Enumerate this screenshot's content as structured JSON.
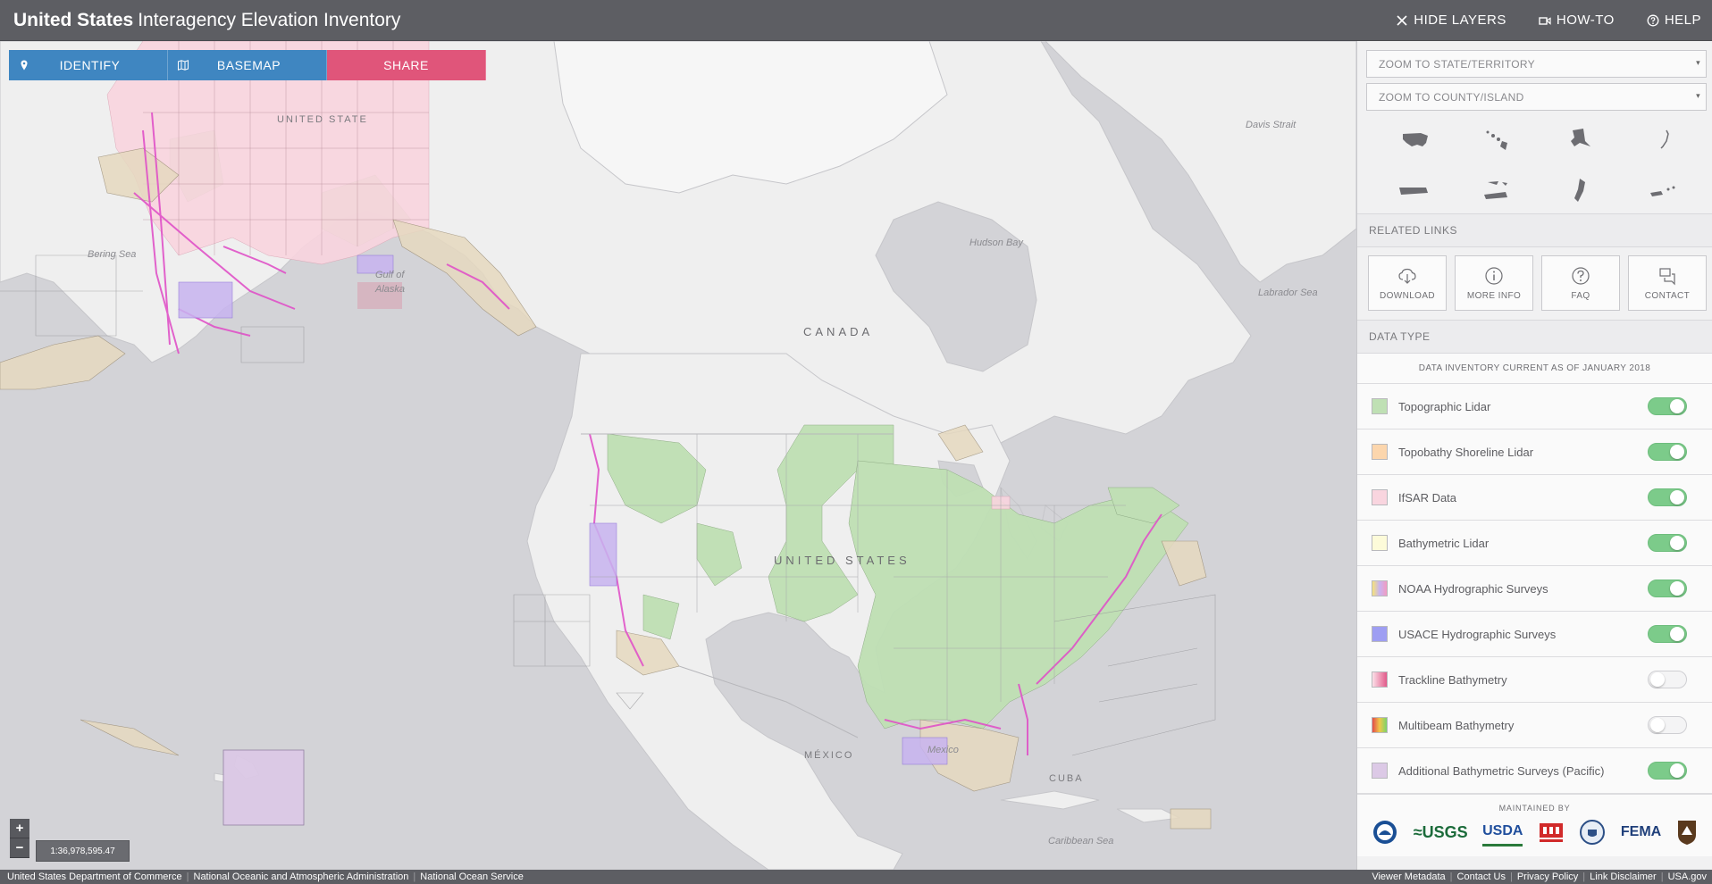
{
  "header": {
    "brand_bold": "United States",
    "brand_rest": "Interagency Elevation Inventory",
    "nav": {
      "hide_layers": "HIDE LAYERS",
      "how_to": "HOW-TO",
      "help": "HELP"
    }
  },
  "toolbar": {
    "identify": "IDENTIFY",
    "basemap": "BASEMAP",
    "share": "SHARE"
  },
  "map": {
    "labels": {
      "canada": "CANADA",
      "united_states": "UNITED STATES",
      "alaska_us": "UNITED STATE",
      "mexico": "MÉXICO",
      "cuba": "CUBA",
      "hudson_bay": "Hudson Bay",
      "labrador_sea": "Labrador Sea",
      "davis_strait": "Davis Strait",
      "bering_sea": "Bering Sea",
      "gulf_of_alaska_1": "Gulf of",
      "gulf_of_alaska_2": "Alaska",
      "caribbean_sea": "Caribbean Sea",
      "mexico_gulf": "Mexico"
    },
    "zoom_in": "+",
    "zoom_out": "−",
    "scale": "1:36,978,595.47"
  },
  "panel": {
    "zoom_state_placeholder": "ZOOM TO STATE/TERRITORY",
    "zoom_county_placeholder": "ZOOM TO COUNTY/ISLAND",
    "caret": "▾",
    "regions": [
      "conus",
      "hawaii",
      "alaska",
      "aleutians",
      "puerto-rico",
      "virgin-islands",
      "guam",
      "cnmi"
    ],
    "related_links_title": "RELATED LINKS",
    "links": {
      "download": "DOWNLOAD",
      "more_info": "MORE INFO",
      "faq": "FAQ",
      "contact": "CONTACT"
    },
    "data_type_title": "DATA TYPE",
    "as_of": "DATA INVENTORY CURRENT AS OF JANUARY 2018",
    "data_types": [
      {
        "label": "Topographic Lidar",
        "color": "#bfe0b4",
        "on": true
      },
      {
        "label": "Topobathy Shoreline Lidar",
        "color": "#fcd6ad",
        "on": true
      },
      {
        "label": "IfSAR Data",
        "color": "#f9d5df",
        "on": true
      },
      {
        "label": "Bathymetric Lidar",
        "color": "#fdfbd9",
        "on": true
      },
      {
        "label": "NOAA Hydrographic Surveys",
        "color": "#c8b4f0",
        "on": true
      },
      {
        "label": "USACE Hydrographic Surveys",
        "color": "#9e9ef2",
        "on": true
      },
      {
        "label": "Trackline Bathymetry",
        "color": "#e25a8a",
        "on": false
      },
      {
        "label": "Multibeam Bathymetry",
        "color": "#f08a4a",
        "on": false
      },
      {
        "label": "Additional Bathymetric Surveys (Pacific)",
        "color": "#dcc9e6",
        "on": true
      }
    ],
    "maintained_by": "MAINTAINED BY",
    "logos": {
      "usgs": "≈USGS",
      "usda": "USDA",
      "fema": "FEMA"
    }
  },
  "footer": {
    "left": [
      "United States Department of Commerce",
      "National Oceanic and Atmospheric Administration",
      "National Ocean Service"
    ],
    "right": [
      "Viewer Metadata",
      "Contact Us",
      "Privacy Policy",
      "Link Disclaimer",
      "USA.gov"
    ]
  }
}
